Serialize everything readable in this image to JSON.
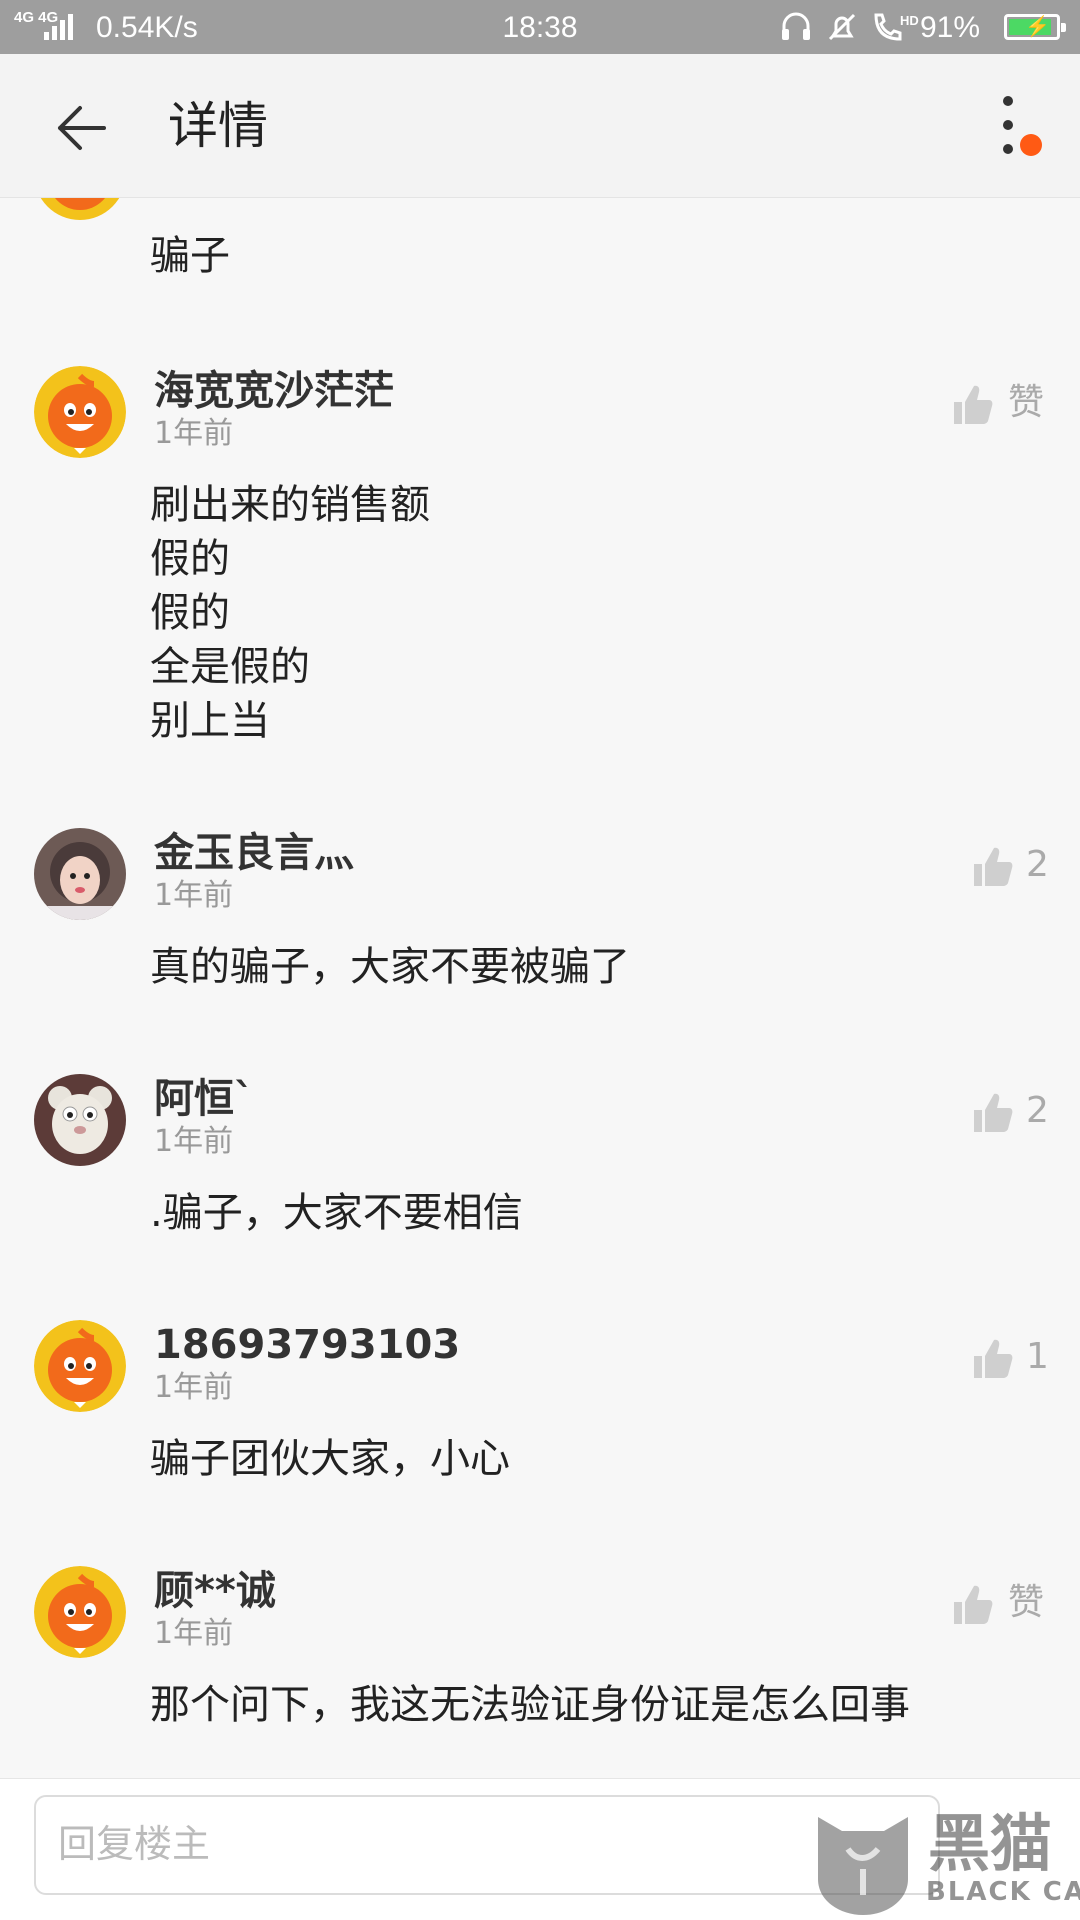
{
  "status_bar": {
    "network": "4G 4G",
    "speed": "0.54K/s",
    "time": "18:38",
    "battery_pct": "91%",
    "battery_level": 0.91,
    "battery_color": "#4cd964",
    "icons": [
      "headset-icon",
      "mute-bell-icon",
      "hd-call-icon"
    ]
  },
  "header": {
    "title": "详情",
    "notify_color": "#ff5a14"
  },
  "partial_comment": {
    "text": "骗子"
  },
  "comments": [
    {
      "username": "海宽宽沙茫茫",
      "time": "1年前",
      "like_label": "赞",
      "avatar": "orange-mascot",
      "lines": [
        "刷出来的销售额",
        "假的",
        "假的",
        "全是假的",
        "别上当"
      ]
    },
    {
      "username": "金玉良言灬",
      "time": "1年前",
      "like_label": "2",
      "avatar": "child-photo",
      "lines": [
        "真的骗子，大家不要被骗了"
      ]
    },
    {
      "username": "阿恒`",
      "time": "1年前",
      "like_label": "2",
      "avatar": "plush-toy-photo",
      "lines": [
        ".骗子，大家不要相信"
      ]
    },
    {
      "username": "18693793103",
      "time": "1年前",
      "like_label": "1",
      "avatar": "orange-mascot",
      "lines": [
        "骗子团伙大家，小心"
      ]
    },
    {
      "username": "顾**诚",
      "time": "1年前",
      "like_label": "赞",
      "avatar": "orange-mascot",
      "lines": [
        "那个问下，我这无法验证身份证是怎么回事"
      ]
    }
  ],
  "reply": {
    "placeholder": "回复楼主"
  },
  "watermark": {
    "text": "黑猫",
    "sub": "BLACK CAT"
  }
}
